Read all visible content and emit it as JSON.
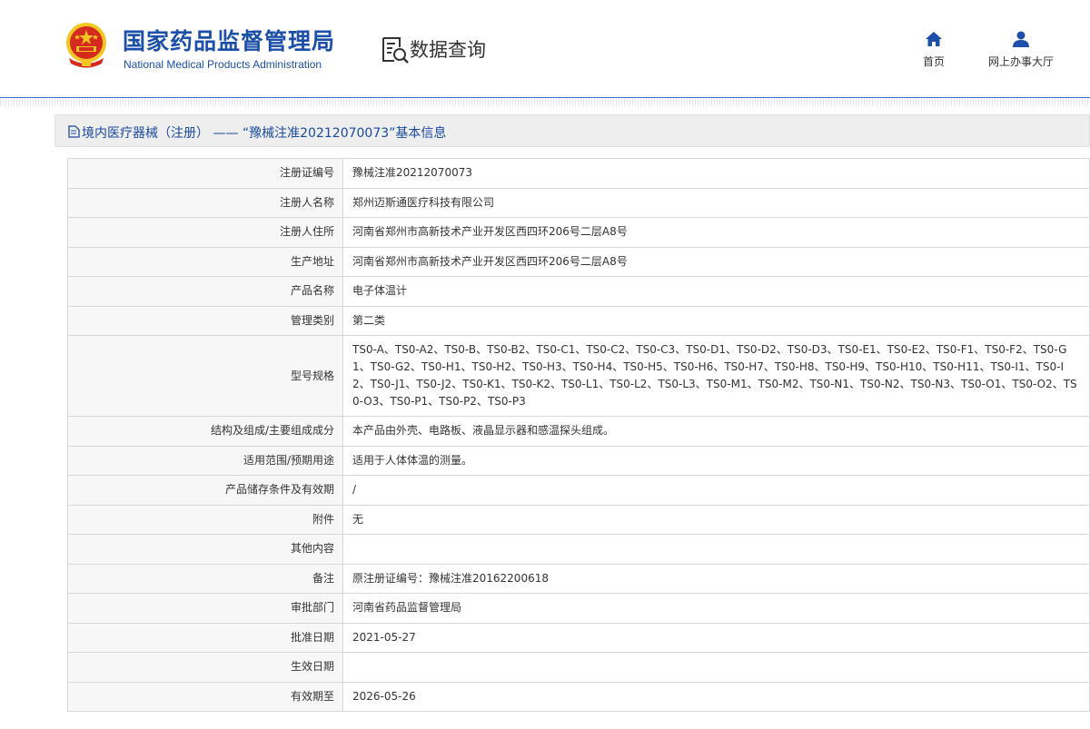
{
  "header": {
    "org_name_cn": "国家药品监督管理局",
    "org_name_en": "National Medical Products Administration",
    "section_title": "数据查询",
    "nav": {
      "home_label": "首页",
      "online_hall_label": "网上办事大厅"
    }
  },
  "record": {
    "title": "境内医疗器械（注册） —— “豫械注准20212070073”基本信息",
    "fields": [
      {
        "label": "注册证编号",
        "value": "豫械注准20212070073"
      },
      {
        "label": "注册人名称",
        "value": "郑州迈斯通医疗科技有限公司"
      },
      {
        "label": "注册人住所",
        "value": "河南省郑州市高新技术产业开发区西四环206号二层A8号"
      },
      {
        "label": "生产地址",
        "value": "河南省郑州市高新技术产业开发区西四环206号二层A8号"
      },
      {
        "label": "产品名称",
        "value": "电子体温计"
      },
      {
        "label": "管理类别",
        "value": "第二类"
      },
      {
        "label": "型号规格",
        "value": "TS0-A、TS0-A2、TS0-B、TS0-B2、TS0-C1、TS0-C2、TS0-C3、TS0-D1、TS0-D2、TS0-D3、TS0-E1、TS0-E2、TS0-F1、TS0-F2、TS0-G1、TS0-G2、TS0-H1、TS0-H2、TS0-H3、TS0-H4、TS0-H5、TS0-H6、TS0-H7、TS0-H8、TS0-H9、TS0-H10、TS0-H11、TS0-I1、TS0-I2、TS0-J1、TS0-J2、TS0-K1、TS0-K2、TS0-L1、TS0-L2、TS0-L3、TS0-M1、TS0-M2、TS0-N1、TS0-N2、TS0-N3、TS0-O1、TS0-O2、TS0-O3、TS0-P1、TS0-P2、TS0-P3"
      },
      {
        "label": "结构及组成/主要组成成分",
        "value": "本产品由外壳、电路板、液晶显示器和感温探头组成。"
      },
      {
        "label": "适用范围/预期用途",
        "value": "适用于人体体温的测量。"
      },
      {
        "label": "产品储存条件及有效期",
        "value": "/"
      },
      {
        "label": "附件",
        "value": "无"
      },
      {
        "label": "其他内容",
        "value": ""
      },
      {
        "label": "备注",
        "value": "原注册证编号：豫械注准20162200618"
      },
      {
        "label": "审批部门",
        "value": "河南省药品监督管理局"
      },
      {
        "label": "批准日期",
        "value": "2021-05-27"
      },
      {
        "label": "生效日期",
        "value": ""
      },
      {
        "label": "有效期至",
        "value": "2026-05-26"
      }
    ]
  },
  "colors": {
    "brand_blue": "#1c4fa8",
    "title_blue": "#1a4aa0",
    "emblem_red": "#d52b1e",
    "emblem_gold": "#f3c623"
  },
  "icons": {
    "logo": "national-emblem-icon",
    "query": "search-document-icon",
    "home": "home-icon",
    "hall": "user-icon",
    "title": "document-icon"
  }
}
